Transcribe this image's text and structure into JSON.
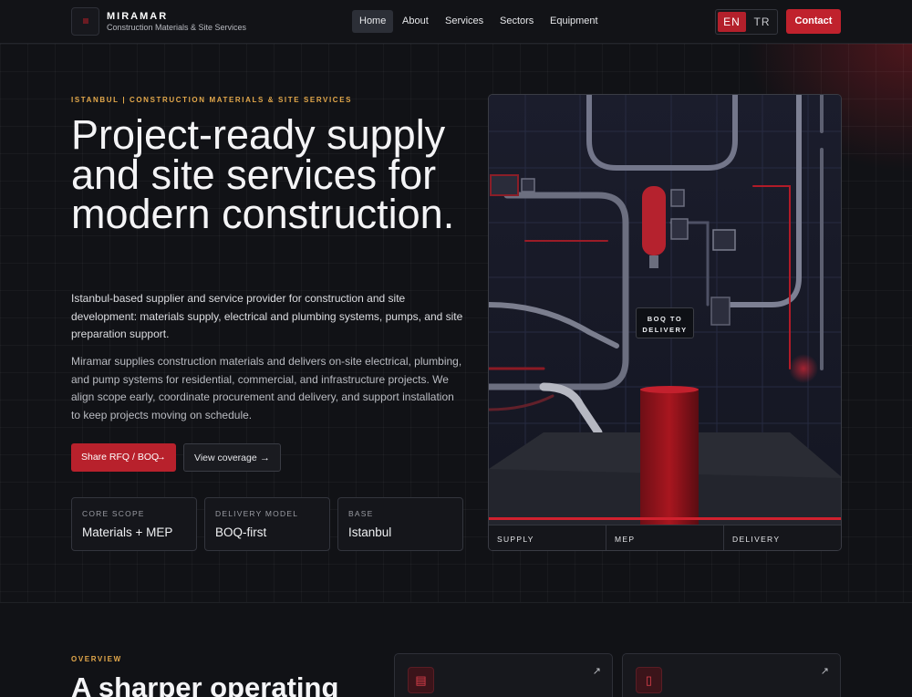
{
  "nav": {
    "brand_name": "MIRAMAR",
    "brand_tagline": "Construction Materials & Site Services",
    "links": [
      "Home",
      "About",
      "Services",
      "Sectors",
      "Equipment"
    ],
    "active_link": "Home",
    "lang_en": "EN",
    "lang_tr": "TR",
    "contact_label": "Contact"
  },
  "hero": {
    "eyebrow": "ISTANBUL | CONSTRUCTION MATERIALS & SITE SERVICES",
    "title": "Project-ready supply and site services for modern construction.",
    "lead": "Istanbul-based supplier and service provider for construction and site development: materials supply, electrical and plumbing systems, pumps, and site preparation support.",
    "body": "Miramar supplies construction materials and delivers on-site electrical, plumbing, and pump systems for residential, commercial, and infrastructure projects. We align scope early, coordinate procurement and delivery, and support installation to keep projects moving on schedule.",
    "primary_cta": "Share RFQ / BOQ",
    "secondary_cta": "View coverage",
    "stats": [
      {
        "label": "CORE SCOPE",
        "value": "Materials + MEP"
      },
      {
        "label": "DELIVERY MODEL",
        "value": "BOQ-first"
      },
      {
        "label": "BASE",
        "value": "Istanbul"
      }
    ]
  },
  "visual": {
    "badge_line1": "BOQ TO",
    "badge_line2": "DELIVERY",
    "tabs": [
      "SUPPLY",
      "MEP",
      "DELIVERY"
    ]
  },
  "overview": {
    "eyebrow": "OVERVIEW",
    "title": "A sharper operating"
  },
  "icons": {
    "card1": "toolbox-icon",
    "card2": "document-icon",
    "external": "arrow-up-right-icon"
  },
  "colors": {
    "accent": "#c0222d",
    "eyebrow": "#e3a84b",
    "background": "#0e0f12"
  }
}
